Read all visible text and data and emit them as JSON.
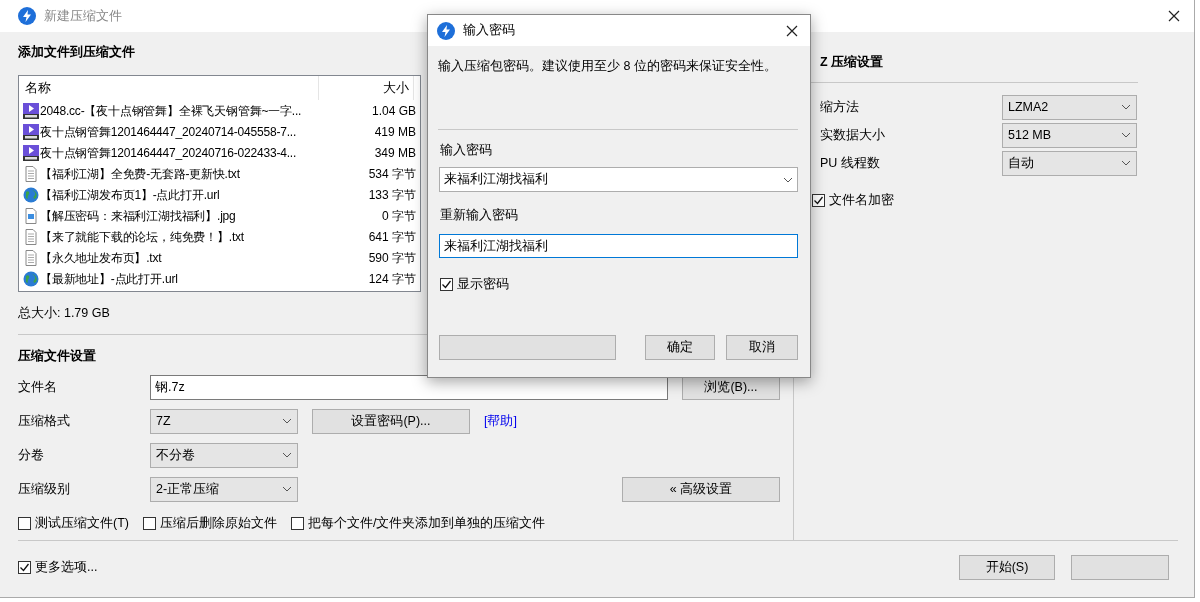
{
  "main_window": {
    "title": "新建压缩文件",
    "add_section": {
      "heading": "添加文件到压缩文件",
      "columns": [
        "名称",
        "大小"
      ],
      "files": [
        {
          "kind": "video",
          "name": "2048.cc-【夜十点钢管舞】全裸飞天钢管舞~一字...",
          "size": "1.04 GB"
        },
        {
          "kind": "video",
          "name": "夜十点钢管舞1201464447_20240714-045558-7...",
          "size": "419 MB"
        },
        {
          "kind": "video",
          "name": "夜十点钢管舞1201464447_20240716-022433-4...",
          "size": "349 MB"
        },
        {
          "kind": "text",
          "name": "【福利江湖】全免费-无套路-更新快.txt",
          "size": "534 字节"
        },
        {
          "kind": "web",
          "name": "【福利江湖发布页1】-点此打开.url",
          "size": "133 字节"
        },
        {
          "kind": "image",
          "name": "【解压密码：来福利江湖找福利】.jpg",
          "size": "0 字节"
        },
        {
          "kind": "text",
          "name": "【来了就能下载的论坛，纯免费！】.txt",
          "size": "641 字节"
        },
        {
          "kind": "text",
          "name": "【永久地址发布页】.txt",
          "size": "590 字节"
        },
        {
          "kind": "web",
          "name": "【最新地址】-点此打开.url",
          "size": "124 字节"
        }
      ],
      "total_size": "总大小: 1.79 GB"
    },
    "settings": {
      "heading": "压缩文件设置",
      "filename": {
        "label": "文件名",
        "value": "钢.7z"
      },
      "browse_button": "浏览(B)...",
      "format": {
        "label": "压缩格式",
        "value": "7Z"
      },
      "password_button": "设置密码(P)...",
      "help_link": "[帮助]",
      "split": {
        "label": "分卷",
        "value": "不分卷"
      },
      "level": {
        "label": "压缩级别",
        "value": "2-正常压缩"
      },
      "advanced_button": "« 高级设置",
      "options": [
        {
          "label": "测试压缩文件(T)",
          "checked": false
        },
        {
          "label": "压缩后删除原始文件",
          "checked": false
        },
        {
          "label": "把每个文件/文件夹添加到单独的压缩文件",
          "checked": false
        }
      ]
    },
    "more_options": {
      "label": "更多选项...",
      "checked": true
    },
    "start_button": "开始(S)",
    "right_panel": {
      "heading": "Z 压缩设置",
      "rows": [
        {
          "label": "缩方法",
          "value": "LZMA2"
        },
        {
          "label": "实数据大小",
          "value": "512 MB"
        },
        {
          "label": "PU 线程数",
          "value": "自动"
        }
      ],
      "encrypt_names": {
        "label": "文件名加密",
        "checked": true
      }
    }
  },
  "dialog": {
    "title": "输入密码",
    "message": "输入压缩包密码。建议使用至少 8 位的密码来保证安全性。",
    "password": {
      "label": "输入密码",
      "value": "来福利江湖找福利"
    },
    "confirm": {
      "label": "重新输入密码",
      "value": "来福利江湖找福利"
    },
    "show_password": {
      "label": "显示密码",
      "checked": true
    },
    "buttons": [
      "确定",
      "取消"
    ]
  }
}
